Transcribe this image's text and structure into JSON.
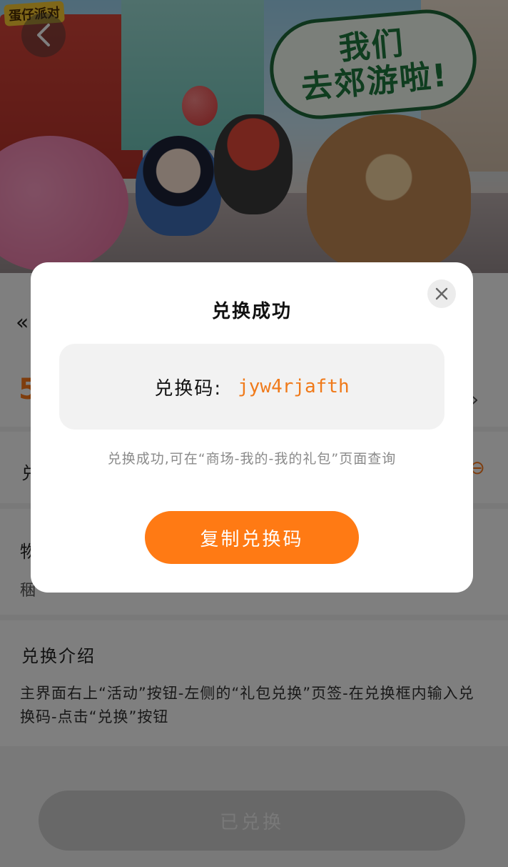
{
  "hero": {
    "logo_text": "蛋仔派对",
    "bubble_line1": "我们",
    "bubble_line2": "去郊游啦!",
    "back_icon": "chevron-left-icon"
  },
  "page": {
    "back_chevron": "«",
    "count_number": "5",
    "right_chevron": "›",
    "code_row_label": "兑",
    "code_row_mark": "⊖",
    "item_row_label": "物",
    "item_row_sub": "稇",
    "intro_title": "兑换介绍",
    "intro_text": "主界面右上“活动”按钮-左侧的“礼包兑换”页签-在兑换框内输入兑换码-点击“兑换”按钮",
    "redeemed_button": "已兑换"
  },
  "modal": {
    "title": "兑换成功",
    "code_label": "兑换码:",
    "code_value": "jyw4rjafth",
    "hint": "兑换成功,可在“商场-我的-我的礼包”页面查询",
    "copy_button": "复制兑换码",
    "close_icon": "close-icon"
  },
  "colors": {
    "accent": "#ff7a14",
    "code_text": "#f07a1a",
    "disabled_button": "#d0d0d0"
  }
}
